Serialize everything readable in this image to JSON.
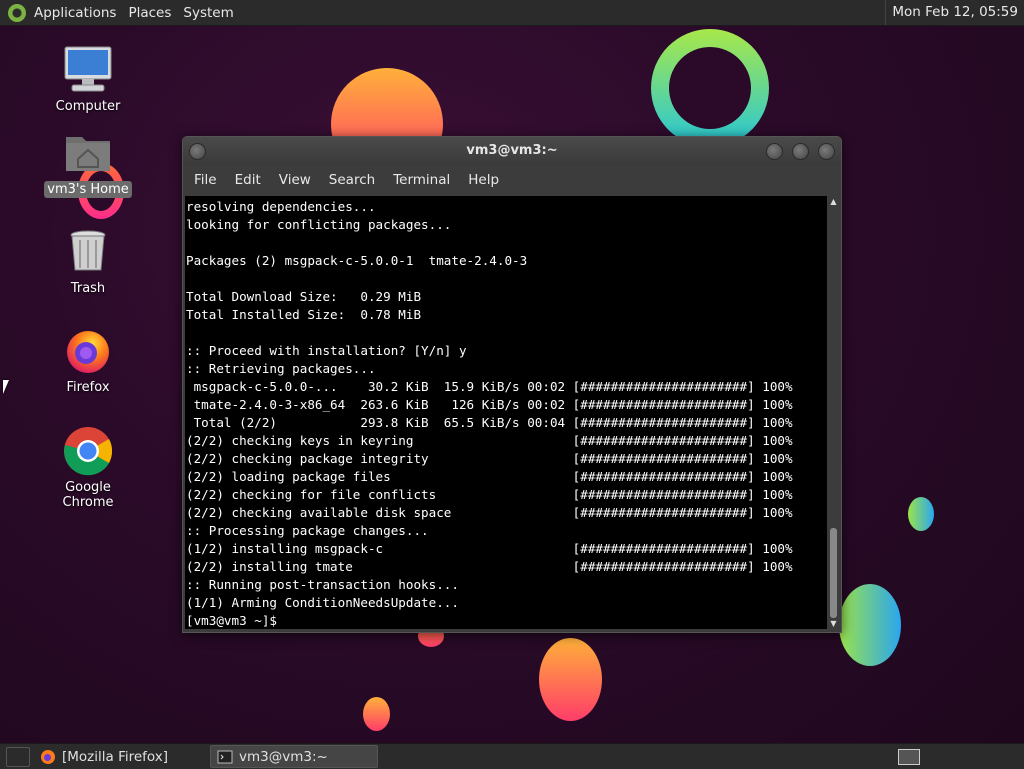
{
  "top_panel": {
    "menus": [
      "Applications",
      "Places",
      "System"
    ],
    "clock": "Mon Feb 12, 05:59"
  },
  "desktop_icons": [
    {
      "label": "Computer",
      "icon": "computer-icon"
    },
    {
      "label": "vm3's Home",
      "icon": "home-folder-icon"
    },
    {
      "label": "Trash",
      "icon": "trash-icon"
    },
    {
      "label": "Firefox",
      "icon": "firefox-icon"
    },
    {
      "label": "Google Chrome",
      "icon": "chrome-icon"
    }
  ],
  "terminal": {
    "title": "vm3@vm3:~",
    "menus": [
      "File",
      "Edit",
      "View",
      "Search",
      "Terminal",
      "Help"
    ],
    "output": "resolving dependencies...\nlooking for conflicting packages...\n\nPackages (2) msgpack-c-5.0.0-1  tmate-2.4.0-3\n\nTotal Download Size:   0.29 MiB\nTotal Installed Size:  0.78 MiB\n\n:: Proceed with installation? [Y/n] y\n:: Retrieving packages...\n msgpack-c-5.0.0-...    30.2 KiB  15.9 KiB/s 00:02 [######################] 100%\n tmate-2.4.0-3-x86_64  263.6 KiB   126 KiB/s 00:02 [######################] 100%\n Total (2/2)           293.8 KiB  65.5 KiB/s 00:04 [######################] 100%\n(2/2) checking keys in keyring                     [######################] 100%\n(2/2) checking package integrity                   [######################] 100%\n(2/2) loading package files                        [######################] 100%\n(2/2) checking for file conflicts                  [######################] 100%\n(2/2) checking available disk space                [######################] 100%\n:: Processing package changes...\n(1/2) installing msgpack-c                         [######################] 100%\n(2/2) installing tmate                             [######################] 100%\n:: Running post-transaction hooks...\n(1/1) Arming ConditionNeedsUpdate...\n[vm3@vm3 ~]$ "
  },
  "taskbar": {
    "items": [
      {
        "label": "[Mozilla Firefox]",
        "icon": "firefox-icon"
      },
      {
        "label": "vm3@vm3:~",
        "icon": "terminal-icon"
      }
    ]
  }
}
